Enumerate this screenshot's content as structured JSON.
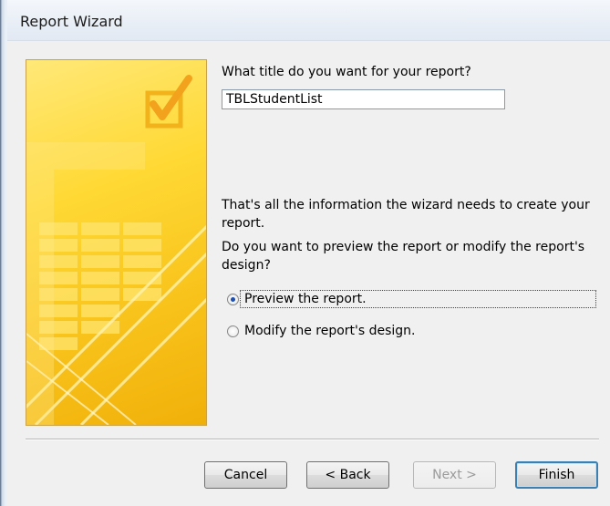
{
  "window": {
    "title": "Report Wizard"
  },
  "icons": {
    "checkbox": "checkbox-icon"
  },
  "colors": {
    "accent": "#ffd935",
    "focus": "#3c7fb1"
  },
  "form": {
    "title_question": "What title do you want for your report?",
    "title_value": "TBLStudentList",
    "info_text_line1": "That's all the information the wizard needs to create your",
    "info_text_line2": "report.",
    "preview_question_line1": "Do you want to preview the report or modify the report's",
    "preview_question_line2": "design?",
    "options": [
      {
        "label": "Preview the report.",
        "selected": true
      },
      {
        "label": "Modify the report's design.",
        "selected": false
      }
    ]
  },
  "buttons": {
    "cancel": "Cancel",
    "back": "< Back",
    "next": "Next >",
    "finish": "Finish"
  }
}
